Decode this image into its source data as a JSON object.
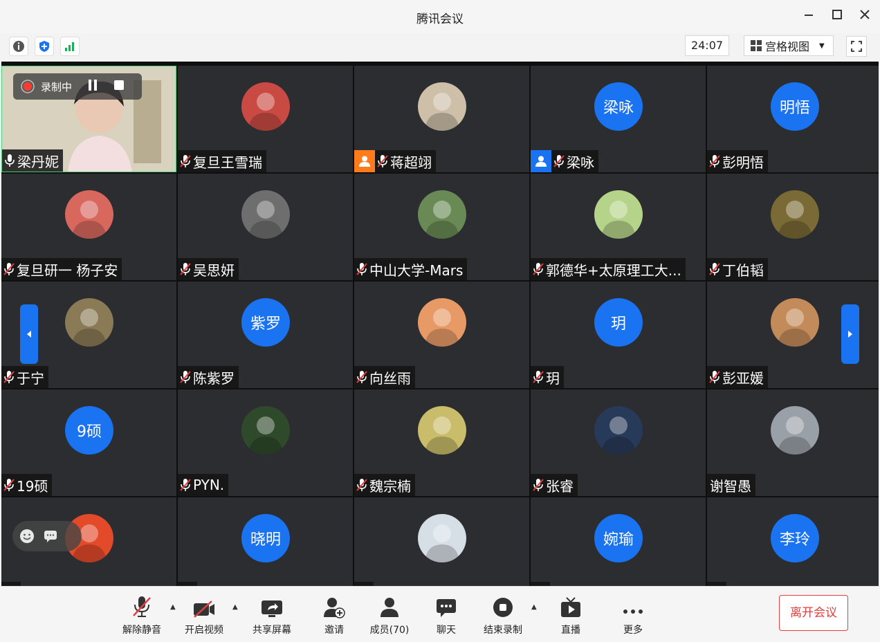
{
  "window": {
    "title": "腾讯会议"
  },
  "toolbar": {
    "timer": "24:07",
    "view_mode": "宫格视图"
  },
  "recording": {
    "label": "录制中"
  },
  "participants": [
    {
      "name": "梁丹妮",
      "kind": "video",
      "mic": "on"
    },
    {
      "name": "复旦王雪瑞",
      "kind": "photo",
      "palette": "#c94a43"
    },
    {
      "name": "蒋超翊",
      "kind": "photo",
      "palette": "#cdbfa8",
      "badge": "orange"
    },
    {
      "name": "梁咏",
      "kind": "text",
      "avatar_text": "梁咏",
      "badge": "blue"
    },
    {
      "name": "彭明悟",
      "kind": "text",
      "avatar_text": "明悟"
    },
    {
      "name": "复旦研一 杨子安",
      "kind": "photo",
      "palette": "#d8685e"
    },
    {
      "name": "吴思妍",
      "kind": "photo",
      "palette": "#6e6e6e"
    },
    {
      "name": "中山大学-Mars",
      "kind": "photo",
      "palette": "#6a8a55"
    },
    {
      "name": "郭德华+太原理工大...",
      "kind": "photo",
      "palette": "#b5d389"
    },
    {
      "name": "丁伯韬",
      "kind": "photo",
      "palette": "#7a6a35"
    },
    {
      "name": "于宁",
      "kind": "photo",
      "palette": "#8a7a55"
    },
    {
      "name": "陈紫罗",
      "kind": "text",
      "avatar_text": "紫罗"
    },
    {
      "name": "向丝雨",
      "kind": "photo",
      "palette": "#e89a66"
    },
    {
      "name": "玥",
      "kind": "text",
      "avatar_text": "玥"
    },
    {
      "name": "彭亚媛",
      "kind": "photo",
      "palette": "#c48b5a"
    },
    {
      "name": "19硕",
      "kind": "text",
      "avatar_text": "9硕"
    },
    {
      "name": "PYN.",
      "kind": "photo",
      "palette": "#2f4a2a"
    },
    {
      "name": "魏宗楠",
      "kind": "photo",
      "palette": "#c9bc6a"
    },
    {
      "name": "张睿",
      "kind": "photo",
      "palette": "#283a5a"
    },
    {
      "name": "谢智愚",
      "kind": "photo",
      "palette": "#9aa0a8",
      "mic": "none"
    },
    {
      "name": "",
      "kind": "photo",
      "palette": "#e24a2a"
    },
    {
      "name": "",
      "kind": "text",
      "avatar_text": "晓明"
    },
    {
      "name": "",
      "kind": "photo",
      "palette": "#d7dfe6"
    },
    {
      "name": "",
      "kind": "text",
      "avatar_text": "婉瑜"
    },
    {
      "name": "",
      "kind": "text",
      "avatar_text": "李玲"
    }
  ],
  "bottom_bar": {
    "unmute": "解除静音",
    "start_video": "开启视频",
    "share_screen": "共享屏幕",
    "invite": "邀请",
    "members": "成员(70)",
    "chat": "聊天",
    "stop_recording": "结束录制",
    "live": "直播",
    "more": "更多",
    "leave": "离开会议"
  },
  "colors": {
    "accent": "#1a73f0",
    "danger": "#e04040",
    "tile_bg": "#2b2d31",
    "grid_bg": "#0f0f0f"
  }
}
